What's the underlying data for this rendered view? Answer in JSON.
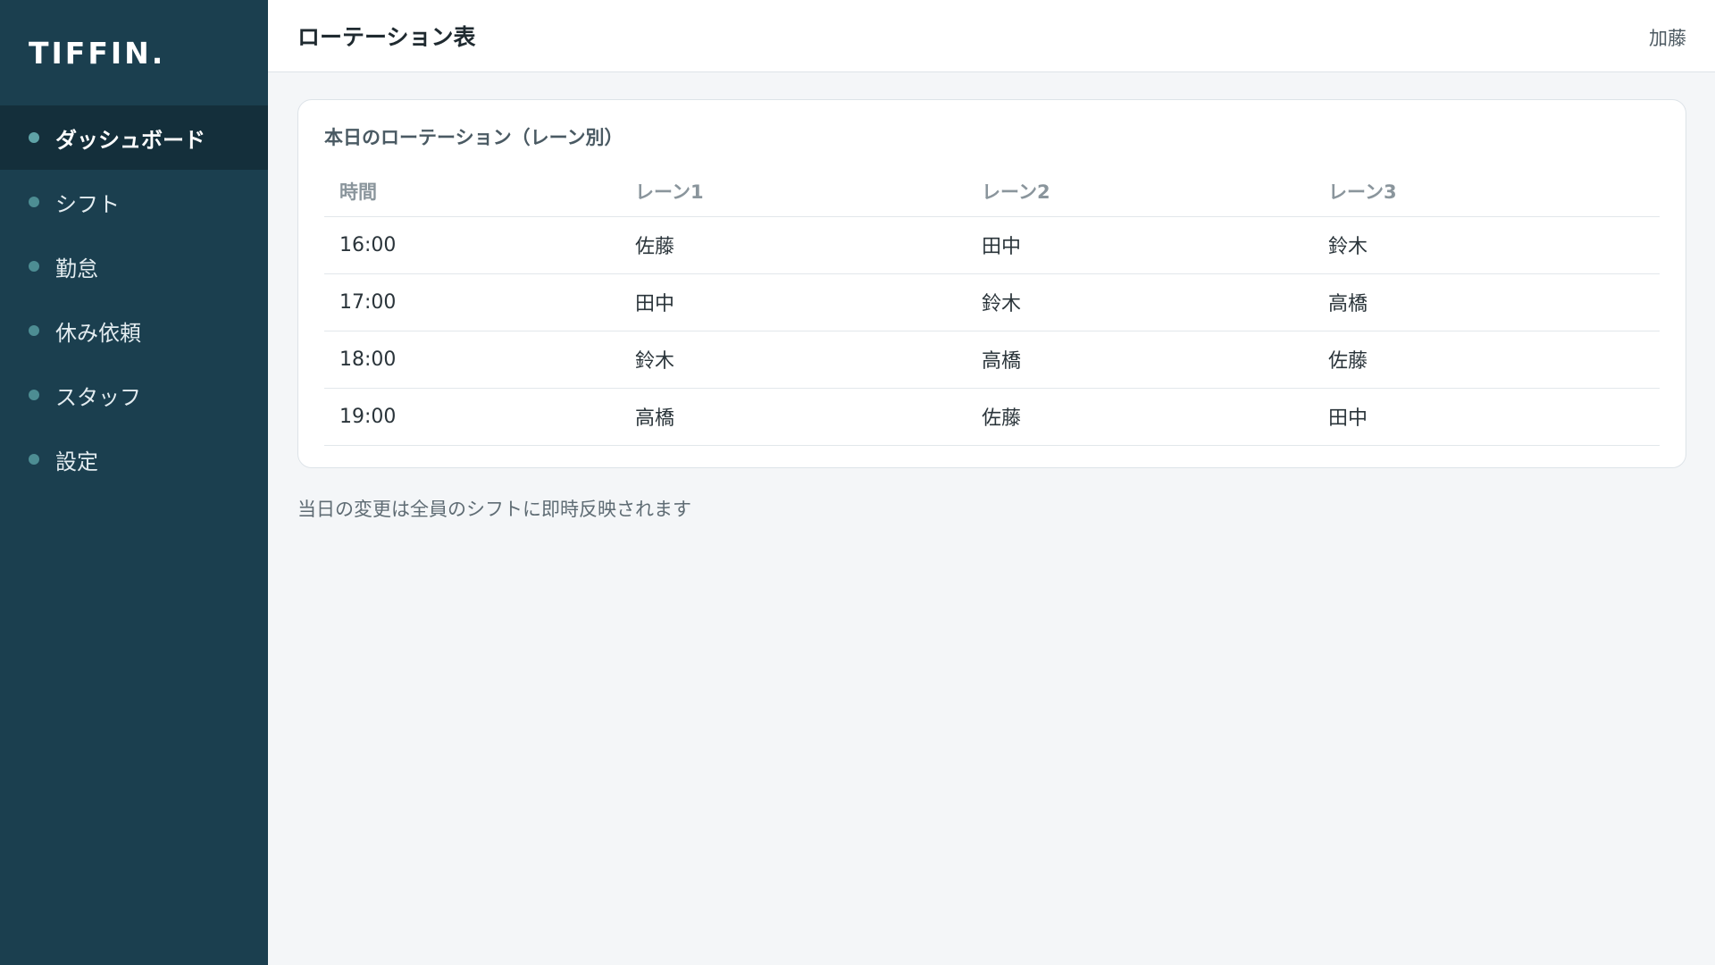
{
  "app": {
    "brand": "TIFFIN.",
    "title": "ローテーション表",
    "user": "加藤"
  },
  "sidebar": {
    "items": [
      {
        "label": "ダッシュボード",
        "active": true
      },
      {
        "label": "シフト",
        "active": false
      },
      {
        "label": "勤怠",
        "active": false
      },
      {
        "label": "休み依頼",
        "active": false
      },
      {
        "label": "スタッフ",
        "active": false
      },
      {
        "label": "設定",
        "active": false
      }
    ]
  },
  "rotation": {
    "title": "本日のローテーション（レーン別）",
    "headers": [
      "時間",
      "レーン1",
      "レーン2",
      "レーン3"
    ],
    "rows": [
      [
        "16:00",
        "佐藤",
        "田中",
        "鈴木"
      ],
      [
        "17:00",
        "田中",
        "鈴木",
        "高橋"
      ],
      [
        "18:00",
        "鈴木",
        "高橋",
        "佐藤"
      ],
      [
        "19:00",
        "高橋",
        "佐藤",
        "田中"
      ]
    ],
    "note": "当日の変更は全員のシフトに即時反映されます"
  },
  "colors": {
    "sidebar_bg": "#1b3f4f",
    "sidebar_active_bg": "#142f3b",
    "accent_dot": "#4d8d93",
    "content_bg": "#f4f6f8"
  }
}
